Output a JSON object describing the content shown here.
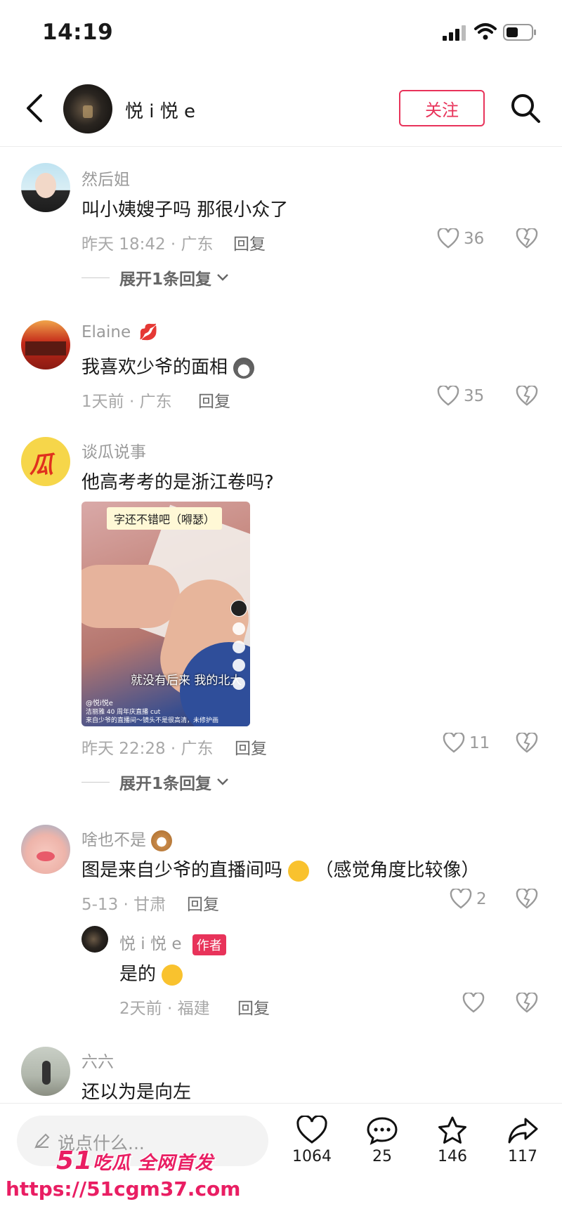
{
  "status_bar": {
    "time": "14:19"
  },
  "header": {
    "name": "悦 i 悦 e",
    "follow_label": "关注"
  },
  "comments": [
    {
      "user": "然后姐",
      "text": "叫小姨嫂子吗 那很小众了",
      "meta": "昨天 18:42 · 广东",
      "reply": "回复",
      "likes": "36",
      "expand": "展开1条回复"
    },
    {
      "user": "Elaine",
      "text": "我喜欢少爷的面相",
      "meta": "1天前 · 广东",
      "reply": "回复",
      "likes": "35"
    },
    {
      "user": "谈瓜说事",
      "text": "他高考考的是浙江卷吗?",
      "meta": "昨天 22:28 · 广东",
      "reply": "回复",
      "likes": "11",
      "expand": "展开1条回复",
      "image": {
        "caption": "字还不错吧（嘚瑟）",
        "subtitle": "就没有后来 我的北大",
        "footer_user": "@悦i悦e",
        "footer_line1": "洁丽雅 40 周年庆直播 cut",
        "footer_line2": "来自少爷的直播间～镜头不是很高清，未修护画"
      }
    },
    {
      "user": "啥也不是",
      "text": "图是来自少爷的直播间吗",
      "text_tail": "（感觉角度比较像）",
      "meta": "5-13 · 甘肃",
      "reply": "回复",
      "likes": "2",
      "sub_reply": {
        "user": "悦 i 悦 e",
        "badge": "作者",
        "text": "是的",
        "meta": "2天前 · 福建",
        "reply": "回复"
      }
    },
    {
      "user": "六六",
      "text": "还以为是向左"
    }
  ],
  "bottom_bar": {
    "placeholder": "说点什么...",
    "like_count": "1064",
    "comment_count": "25",
    "star_count": "146",
    "share_count": "117"
  },
  "watermark": {
    "line1": "吃瓜 全网首发",
    "number": "51",
    "url": "https://51cgm37.com"
  },
  "colors": {
    "accent": "#e8335a",
    "muted": "#9a9a9a"
  }
}
